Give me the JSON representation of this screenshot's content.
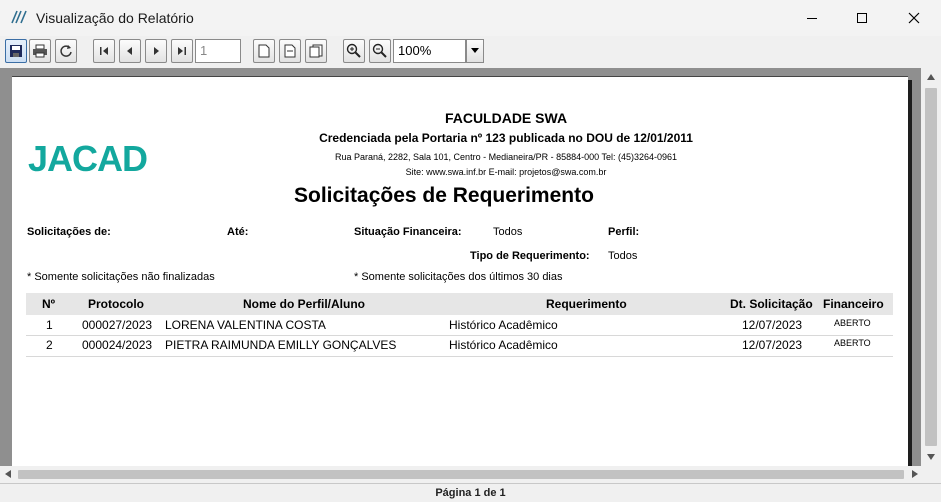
{
  "window": {
    "title": "Visualização do Relatório"
  },
  "toolbar": {
    "page_value": "1",
    "zoom_value": "100%"
  },
  "report": {
    "logo_text": "JACAD",
    "institution": "FACULDADE SWA",
    "accreditation": "Credenciada pela Portaria nº 123 publicada no DOU de 12/01/2011",
    "address": "Rua Paraná, 2282, Sala 101, Centro - Medianeira/PR - 85884-000 Tel: (45)3264-0961",
    "site": "Site: www.swa.inf.br   E-mail: projetos@swa.com.br",
    "title": "Solicitações de Requerimento",
    "filters": {
      "from_label": "Solicitações de:",
      "to_label": "Até:",
      "fin_label": "Situação Financeira:",
      "fin_value": "Todos",
      "profile_label": "Perfil:",
      "type_label": "Tipo de Requerimento:",
      "type_value": "Todos"
    },
    "notes": {
      "left": "* Somente solicitações não finalizadas",
      "right": "* Somente solicitações dos últimos 30 dias"
    },
    "table": {
      "headers": [
        "Nº",
        "Protocolo",
        "Nome do Perfil/Aluno",
        "Requerimento",
        "Dt. Solicitação",
        "Financeiro"
      ],
      "rows": [
        [
          "1",
          "000027/2023",
          "LORENA VALENTINA COSTA",
          "Histórico Acadêmico",
          "12/07/2023",
          "ABERTO"
        ],
        [
          "2",
          "000024/2023",
          "PIETRA RAIMUNDA EMILLY GONÇALVES",
          "Histórico Acadêmico",
          "12/07/2023",
          "ABERTO"
        ]
      ]
    }
  },
  "status": {
    "page_text": "Página 1 de 1"
  },
  "colors": {
    "logo": "#13a89e",
    "page_bg": "#ffffff",
    "viewport_bg": "#8f8f8f"
  }
}
